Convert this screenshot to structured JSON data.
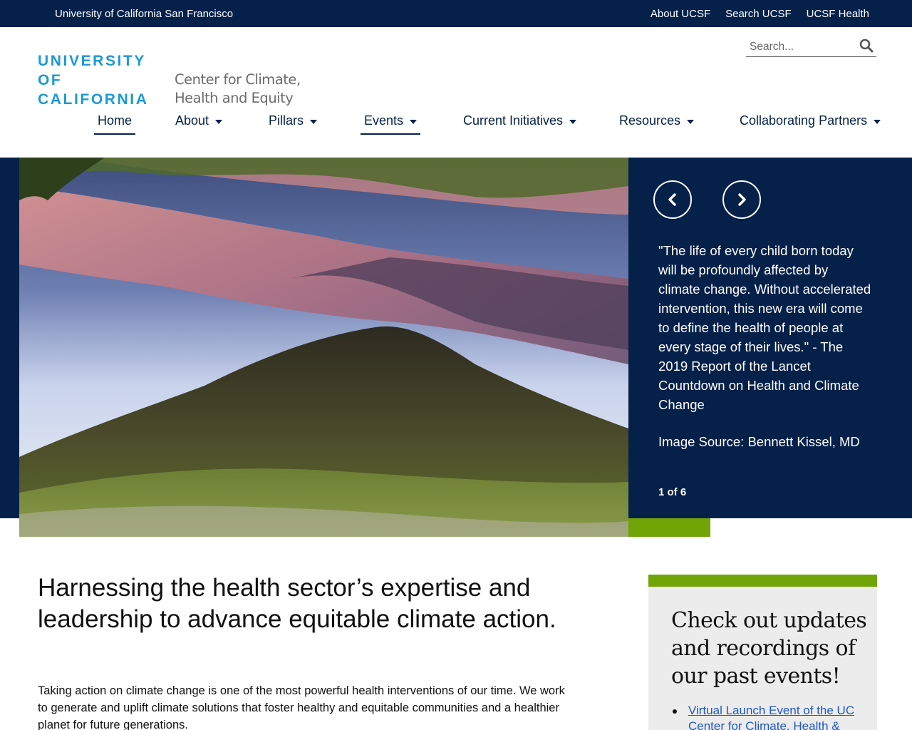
{
  "topbar": {
    "org": "University of California San Francisco",
    "links": [
      "About UCSF",
      "Search UCSF",
      "UCSF Health"
    ]
  },
  "header": {
    "logo_lines": [
      "UNIVERSITY",
      "OF",
      "CALIFORNIA"
    ],
    "center_lines": [
      "Center for Climate,",
      "Health and Equity"
    ],
    "search_placeholder": "Search...",
    "search_icon": "search-icon"
  },
  "nav": {
    "items": [
      {
        "label": "Home",
        "dropdown": false,
        "active": true
      },
      {
        "label": "About",
        "dropdown": true,
        "active": false
      },
      {
        "label": "Pillars",
        "dropdown": true,
        "active": false
      },
      {
        "label": "Events",
        "dropdown": true,
        "active": true
      },
      {
        "label": "Current Initiatives",
        "dropdown": true,
        "active": false
      },
      {
        "label": "Resources",
        "dropdown": true,
        "active": false
      },
      {
        "label": "Collaborating Partners",
        "dropdown": true,
        "active": false
      }
    ]
  },
  "hero": {
    "quote": "\"The life of every child born today will be profoundly affected by climate change. Without accelerated intervention, this new era will come to define the health of people at every stage of their lives.\" - The 2019 Report of the Lancet Countdown on Health and Climate Change",
    "source": "Image Source: Bennett Kissel, MD",
    "counter": "1 of 6",
    "prev_icon": "chevron-left-icon",
    "next_icon": "chevron-right-icon"
  },
  "main": {
    "headline": "Harnessing the health sector’s expertise and leadership to advance equitable climate action.",
    "intro": "Taking action on climate change is one of the most powerful health interventions of our time. We work to generate and uplift climate solutions that foster healthy and equitable communities and a healthier planet for future generations."
  },
  "sidebar": {
    "title": "Check out updates and recordings of our past events!",
    "links": [
      "Virtual Launch Event of the UC Center for Climate, Health & Equity"
    ]
  },
  "colors": {
    "navy": "#052049",
    "accent_blue": "#1a9ad6",
    "green": "#71a406",
    "link": "#1f58c4"
  }
}
